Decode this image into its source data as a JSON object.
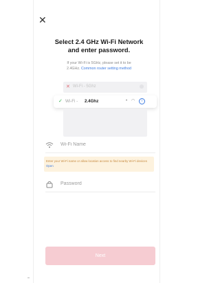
{
  "header": {
    "close_label": "✕"
  },
  "title": {
    "line1": "Select 2.4 GHz Wi-Fi Network",
    "line2": "and enter password."
  },
  "hint": {
    "line1": "If your Wi-Fi is 5GHz, please set it to be",
    "line2_prefix": "2.4GHz.",
    "link_text": "Common router setting method"
  },
  "network_list": {
    "unsupported": {
      "prefix": "Wi-Fi -",
      "band": "5Ghz"
    },
    "selected": {
      "prefix": "Wi-Fi -",
      "band": "2.4Ghz"
    }
  },
  "form": {
    "wifi_name": {
      "placeholder": "Wi-Fi Name",
      "value": ""
    },
    "password": {
      "placeholder": "Password",
      "value": ""
    }
  },
  "notice": {
    "text": "Enter your Wi-Fi name or allow location access to find nearby Wi-Fi devices",
    "link": "Open"
  },
  "next_button": {
    "label": "Next"
  },
  "colors": {
    "accent_link": "#3d7be0",
    "check_green": "#2fb24a",
    "error_red": "#e06b75",
    "next_disabled": "#f6ccd2",
    "notice_bg": "#fdf2de"
  },
  "icons": {
    "close": "close-icon",
    "wifi_field": "wifi-icon",
    "password_field": "lock-icon",
    "selected_check": "check-icon",
    "unsupported_mark": "x-icon",
    "info": "info-icon"
  }
}
